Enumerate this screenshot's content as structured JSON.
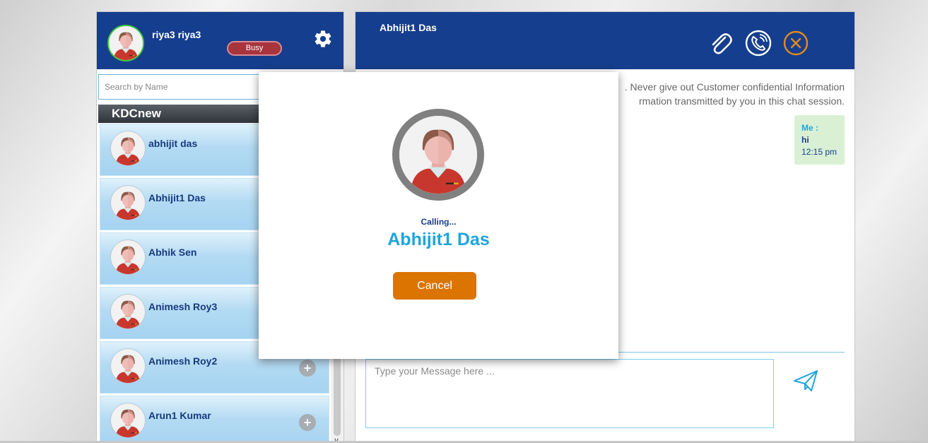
{
  "colors": {
    "header_bg": "#163e8e",
    "accent": "#1ea5dd",
    "cancel": "#dc7402",
    "status_busy": "#a8343d"
  },
  "user": {
    "name": "riya3 riya3",
    "status": "Busy",
    "avatar_icon": "person-avatar-icon",
    "settings_icon": "gear-icon"
  },
  "search": {
    "placeholder": "Search by Name"
  },
  "group": {
    "name": "KDCnew"
  },
  "contacts": [
    {
      "name": "abhijit das",
      "add": "+"
    },
    {
      "name": "Abhijit1 Das",
      "add": "+"
    },
    {
      "name": "Abhik Sen",
      "add": "+"
    },
    {
      "name": "Animesh Roy3",
      "add": "+"
    },
    {
      "name": "Animesh Roy2",
      "add": "+"
    },
    {
      "name": "Arun1 Kumar",
      "add": "+"
    }
  ],
  "chat": {
    "title": "Abhijit1 Das",
    "icons": [
      "paperclip-icon",
      "phone-call-icon",
      "close-icon",
      "send-icon"
    ],
    "disclaimer_line1": ". Never give out Customer confidential Information",
    "disclaimer_line2": "rmation transmitted by you in this chat session.",
    "message": {
      "sender": "Me :",
      "text": "hi",
      "time": "12:15 pm"
    },
    "input_placeholder": "Type your Message here ..."
  },
  "call_modal": {
    "status": "Calling...",
    "callee": "Abhijit1 Das",
    "cancel_label": "Cancel"
  }
}
